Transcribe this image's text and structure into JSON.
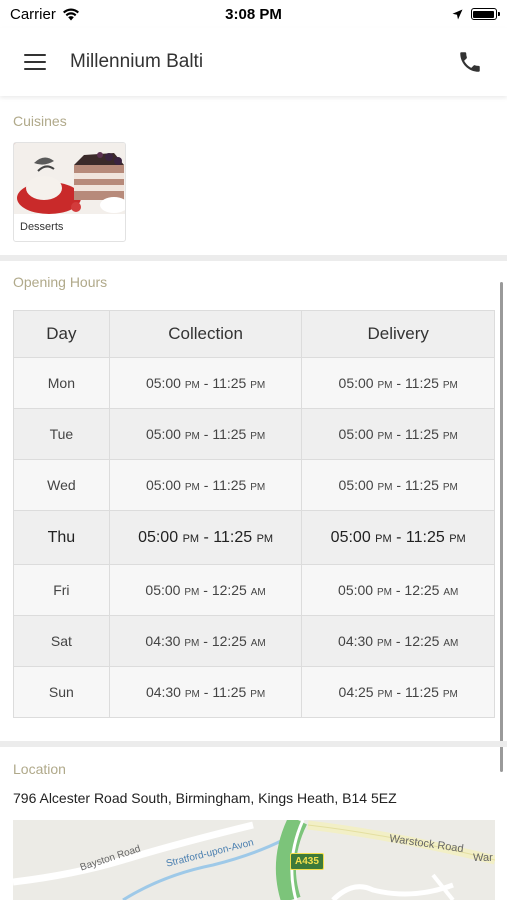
{
  "status_bar": {
    "carrier": "Carrier",
    "time": "3:08 PM"
  },
  "app_bar": {
    "title": "Millennium Balti",
    "menu_icon": "hamburger-menu-icon",
    "call_icon": "phone-icon"
  },
  "cuisines": {
    "heading": "Cuisines",
    "items": [
      {
        "label": "Desserts"
      }
    ]
  },
  "opening_hours": {
    "heading": "Opening Hours",
    "columns": [
      "Day",
      "Collection",
      "Delivery"
    ],
    "rows": [
      {
        "day": "Mon",
        "collection": {
          "open": "05:00",
          "open_ampm": "PM",
          "close": "11:25",
          "close_ampm": "PM"
        },
        "delivery": {
          "open": "05:00",
          "open_ampm": "PM",
          "close": "11:25",
          "close_ampm": "PM"
        }
      },
      {
        "day": "Tue",
        "collection": {
          "open": "05:00",
          "open_ampm": "PM",
          "close": "11:25",
          "close_ampm": "PM"
        },
        "delivery": {
          "open": "05:00",
          "open_ampm": "PM",
          "close": "11:25",
          "close_ampm": "PM"
        }
      },
      {
        "day": "Wed",
        "collection": {
          "open": "05:00",
          "open_ampm": "PM",
          "close": "11:25",
          "close_ampm": "PM"
        },
        "delivery": {
          "open": "05:00",
          "open_ampm": "PM",
          "close": "11:25",
          "close_ampm": "PM"
        }
      },
      {
        "day": "Thu",
        "collection": {
          "open": "05:00",
          "open_ampm": "PM",
          "close": "11:25",
          "close_ampm": "PM"
        },
        "delivery": {
          "open": "05:00",
          "open_ampm": "PM",
          "close": "11:25",
          "close_ampm": "PM"
        }
      },
      {
        "day": "Fri",
        "collection": {
          "open": "05:00",
          "open_ampm": "PM",
          "close": "12:25",
          "close_ampm": "AM"
        },
        "delivery": {
          "open": "05:00",
          "open_ampm": "PM",
          "close": "12:25",
          "close_ampm": "AM"
        }
      },
      {
        "day": "Sat",
        "collection": {
          "open": "04:30",
          "open_ampm": "PM",
          "close": "12:25",
          "close_ampm": "AM"
        },
        "delivery": {
          "open": "04:30",
          "open_ampm": "PM",
          "close": "12:25",
          "close_ampm": "AM"
        }
      },
      {
        "day": "Sun",
        "collection": {
          "open": "04:30",
          "open_ampm": "PM",
          "close": "11:25",
          "close_ampm": "PM"
        },
        "delivery": {
          "open": "04:25",
          "open_ampm": "PM",
          "close": "11:25",
          "close_ampm": "PM"
        }
      }
    ],
    "highlighted_day": "Thu"
  },
  "location": {
    "heading": "Location",
    "address": "796 Alcester Road South, Birmingham, Kings Heath, B14 5EZ",
    "map": {
      "labels": [
        "Bayston Road",
        "Stratford-upon-Avon",
        "Warstock Road",
        "War"
      ],
      "road_badge": "A435"
    }
  },
  "colors": {
    "section_heading": "#b0a98a",
    "table_header_bg": "#efefef",
    "section_divider": "#ececec"
  }
}
